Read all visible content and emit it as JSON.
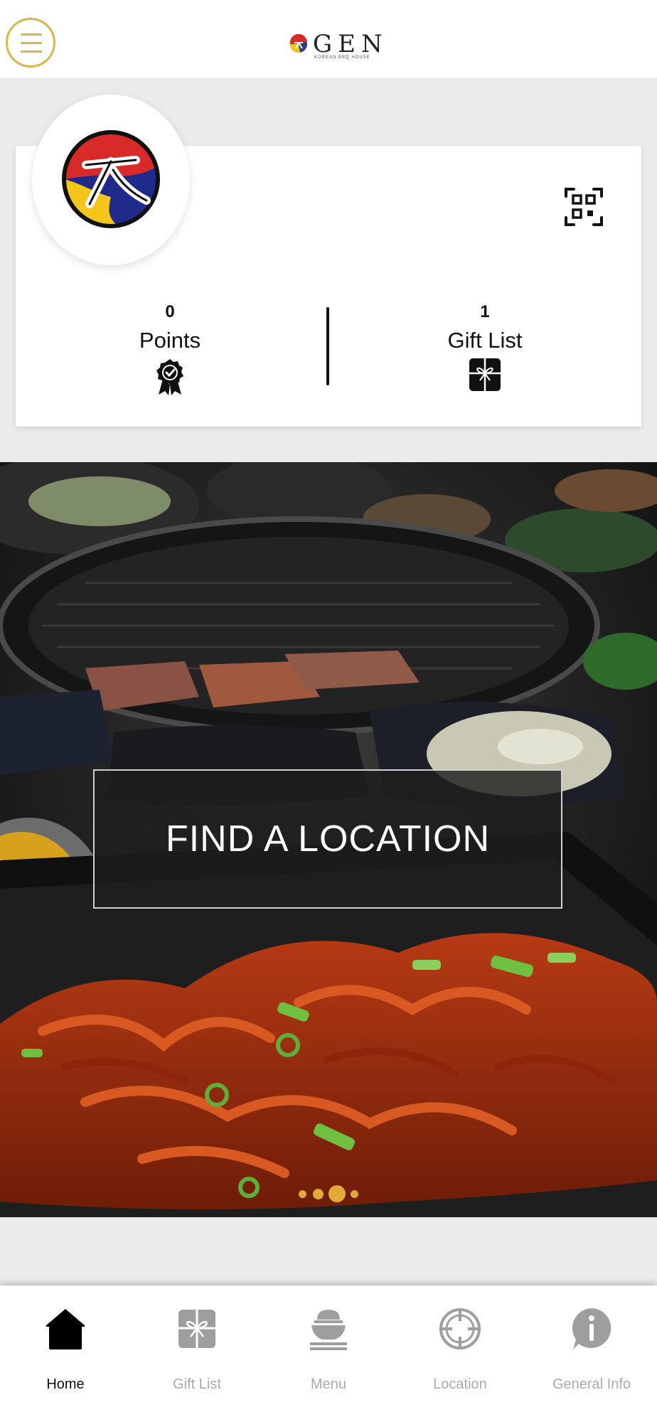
{
  "header": {
    "menu_icon": "hamburger-icon",
    "logo_text": "GEN",
    "logo_subtext": "KOREAN BBQ HOUSE",
    "accent_color": "#d9b54a"
  },
  "profile": {
    "qr_icon": "qr-scan-icon",
    "points": {
      "count": "0",
      "label": "Points",
      "icon": "badge-check-icon"
    },
    "gifts": {
      "count": "1",
      "label": "Gift List",
      "icon": "gift-icon"
    }
  },
  "hero": {
    "cta_label": "FIND A LOCATION",
    "slides_total": 4,
    "active_slide": 3,
    "dot_color": "#e2a93a"
  },
  "bottom_nav": {
    "items": [
      {
        "label": "Home",
        "icon": "home-icon",
        "active": true
      },
      {
        "label": "Gift List",
        "icon": "gift-icon",
        "active": false
      },
      {
        "label": "Menu",
        "icon": "bowl-icon",
        "active": false
      },
      {
        "label": "Location",
        "icon": "crosshair-icon",
        "active": false
      },
      {
        "label": "General Info",
        "icon": "info-icon",
        "active": false
      }
    ]
  }
}
